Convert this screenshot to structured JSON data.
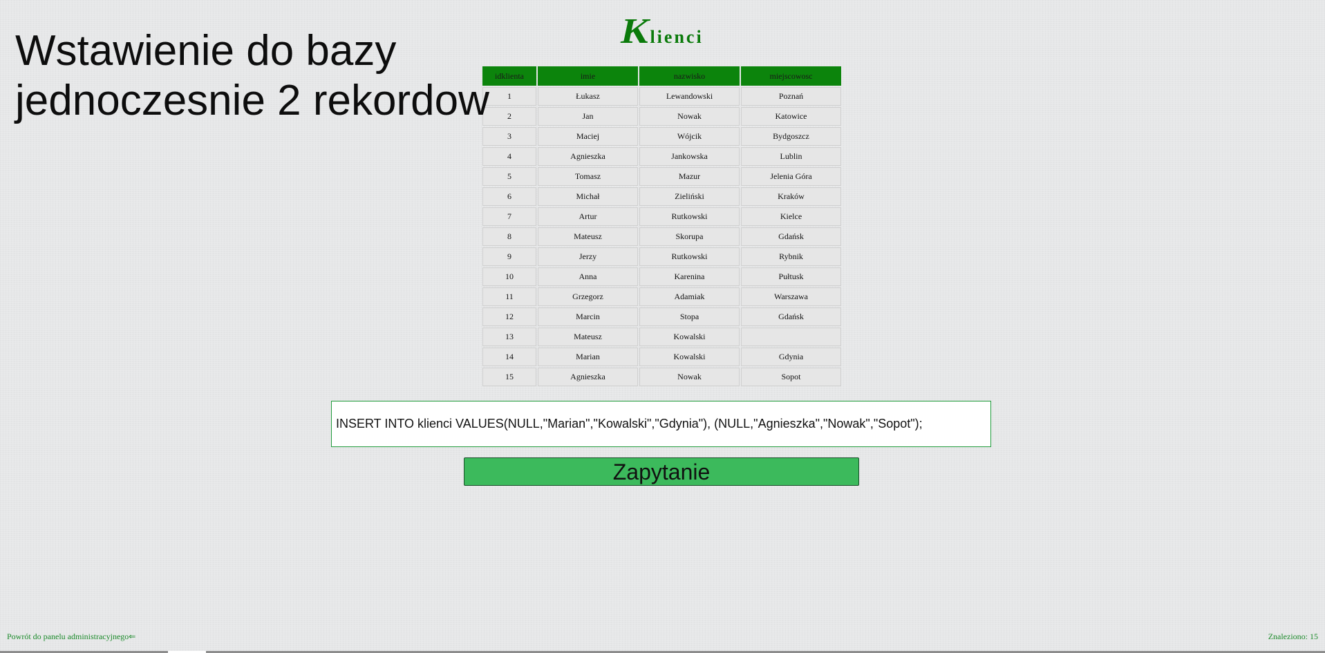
{
  "heading": {
    "line1": "Wstawienie do bazy",
    "line2": "jednoczesnie 2 rekordow"
  },
  "logo": {
    "first_letter": "K",
    "rest": "lienci"
  },
  "table": {
    "headers": [
      "idklienta",
      "imie",
      "nazwisko",
      "miejscowosc"
    ],
    "rows": [
      [
        "1",
        "Łukasz",
        "Lewandowski",
        "Poznań"
      ],
      [
        "2",
        "Jan",
        "Nowak",
        "Katowice"
      ],
      [
        "3",
        "Maciej",
        "Wójcik",
        "Bydgoszcz"
      ],
      [
        "4",
        "Agnieszka",
        "Jankowska",
        "Lublin"
      ],
      [
        "5",
        "Tomasz",
        "Mazur",
        "Jelenia Góra"
      ],
      [
        "6",
        "Michał",
        "Zieliński",
        "Kraków"
      ],
      [
        "7",
        "Artur",
        "Rutkowski",
        "Kielce"
      ],
      [
        "8",
        "Mateusz",
        "Skorupa",
        "Gdańsk"
      ],
      [
        "9",
        "Jerzy",
        "Rutkowski",
        "Rybnik"
      ],
      [
        "10",
        "Anna",
        "Karenina",
        "Pułtusk"
      ],
      [
        "11",
        "Grzegorz",
        "Adamiak",
        "Warszawa"
      ],
      [
        "12",
        "Marcin",
        "Stopa",
        "Gdańsk"
      ],
      [
        "13",
        "Mateusz",
        "Kowalski",
        ""
      ],
      [
        "14",
        "Marian",
        "Kowalski",
        "Gdynia"
      ],
      [
        "15",
        "Agnieszka",
        "Nowak",
        "Sopot"
      ]
    ]
  },
  "query": {
    "value": "INSERT INTO klienci VALUES(NULL,\"Marian\",\"Kowalski\",\"Gdynia\"), (NULL,\"Agnieszka\",\"Nowak\",\"Sopot\");"
  },
  "submit": {
    "label": "Zapytanie"
  },
  "footer": {
    "back_link": "Powrót do panelu administracyjnego⇐",
    "count": "Znaleziono: 15"
  },
  "colors": {
    "accent_green": "#0c840c",
    "button_green": "#3cba5c",
    "link_green": "#1b8a2a"
  }
}
